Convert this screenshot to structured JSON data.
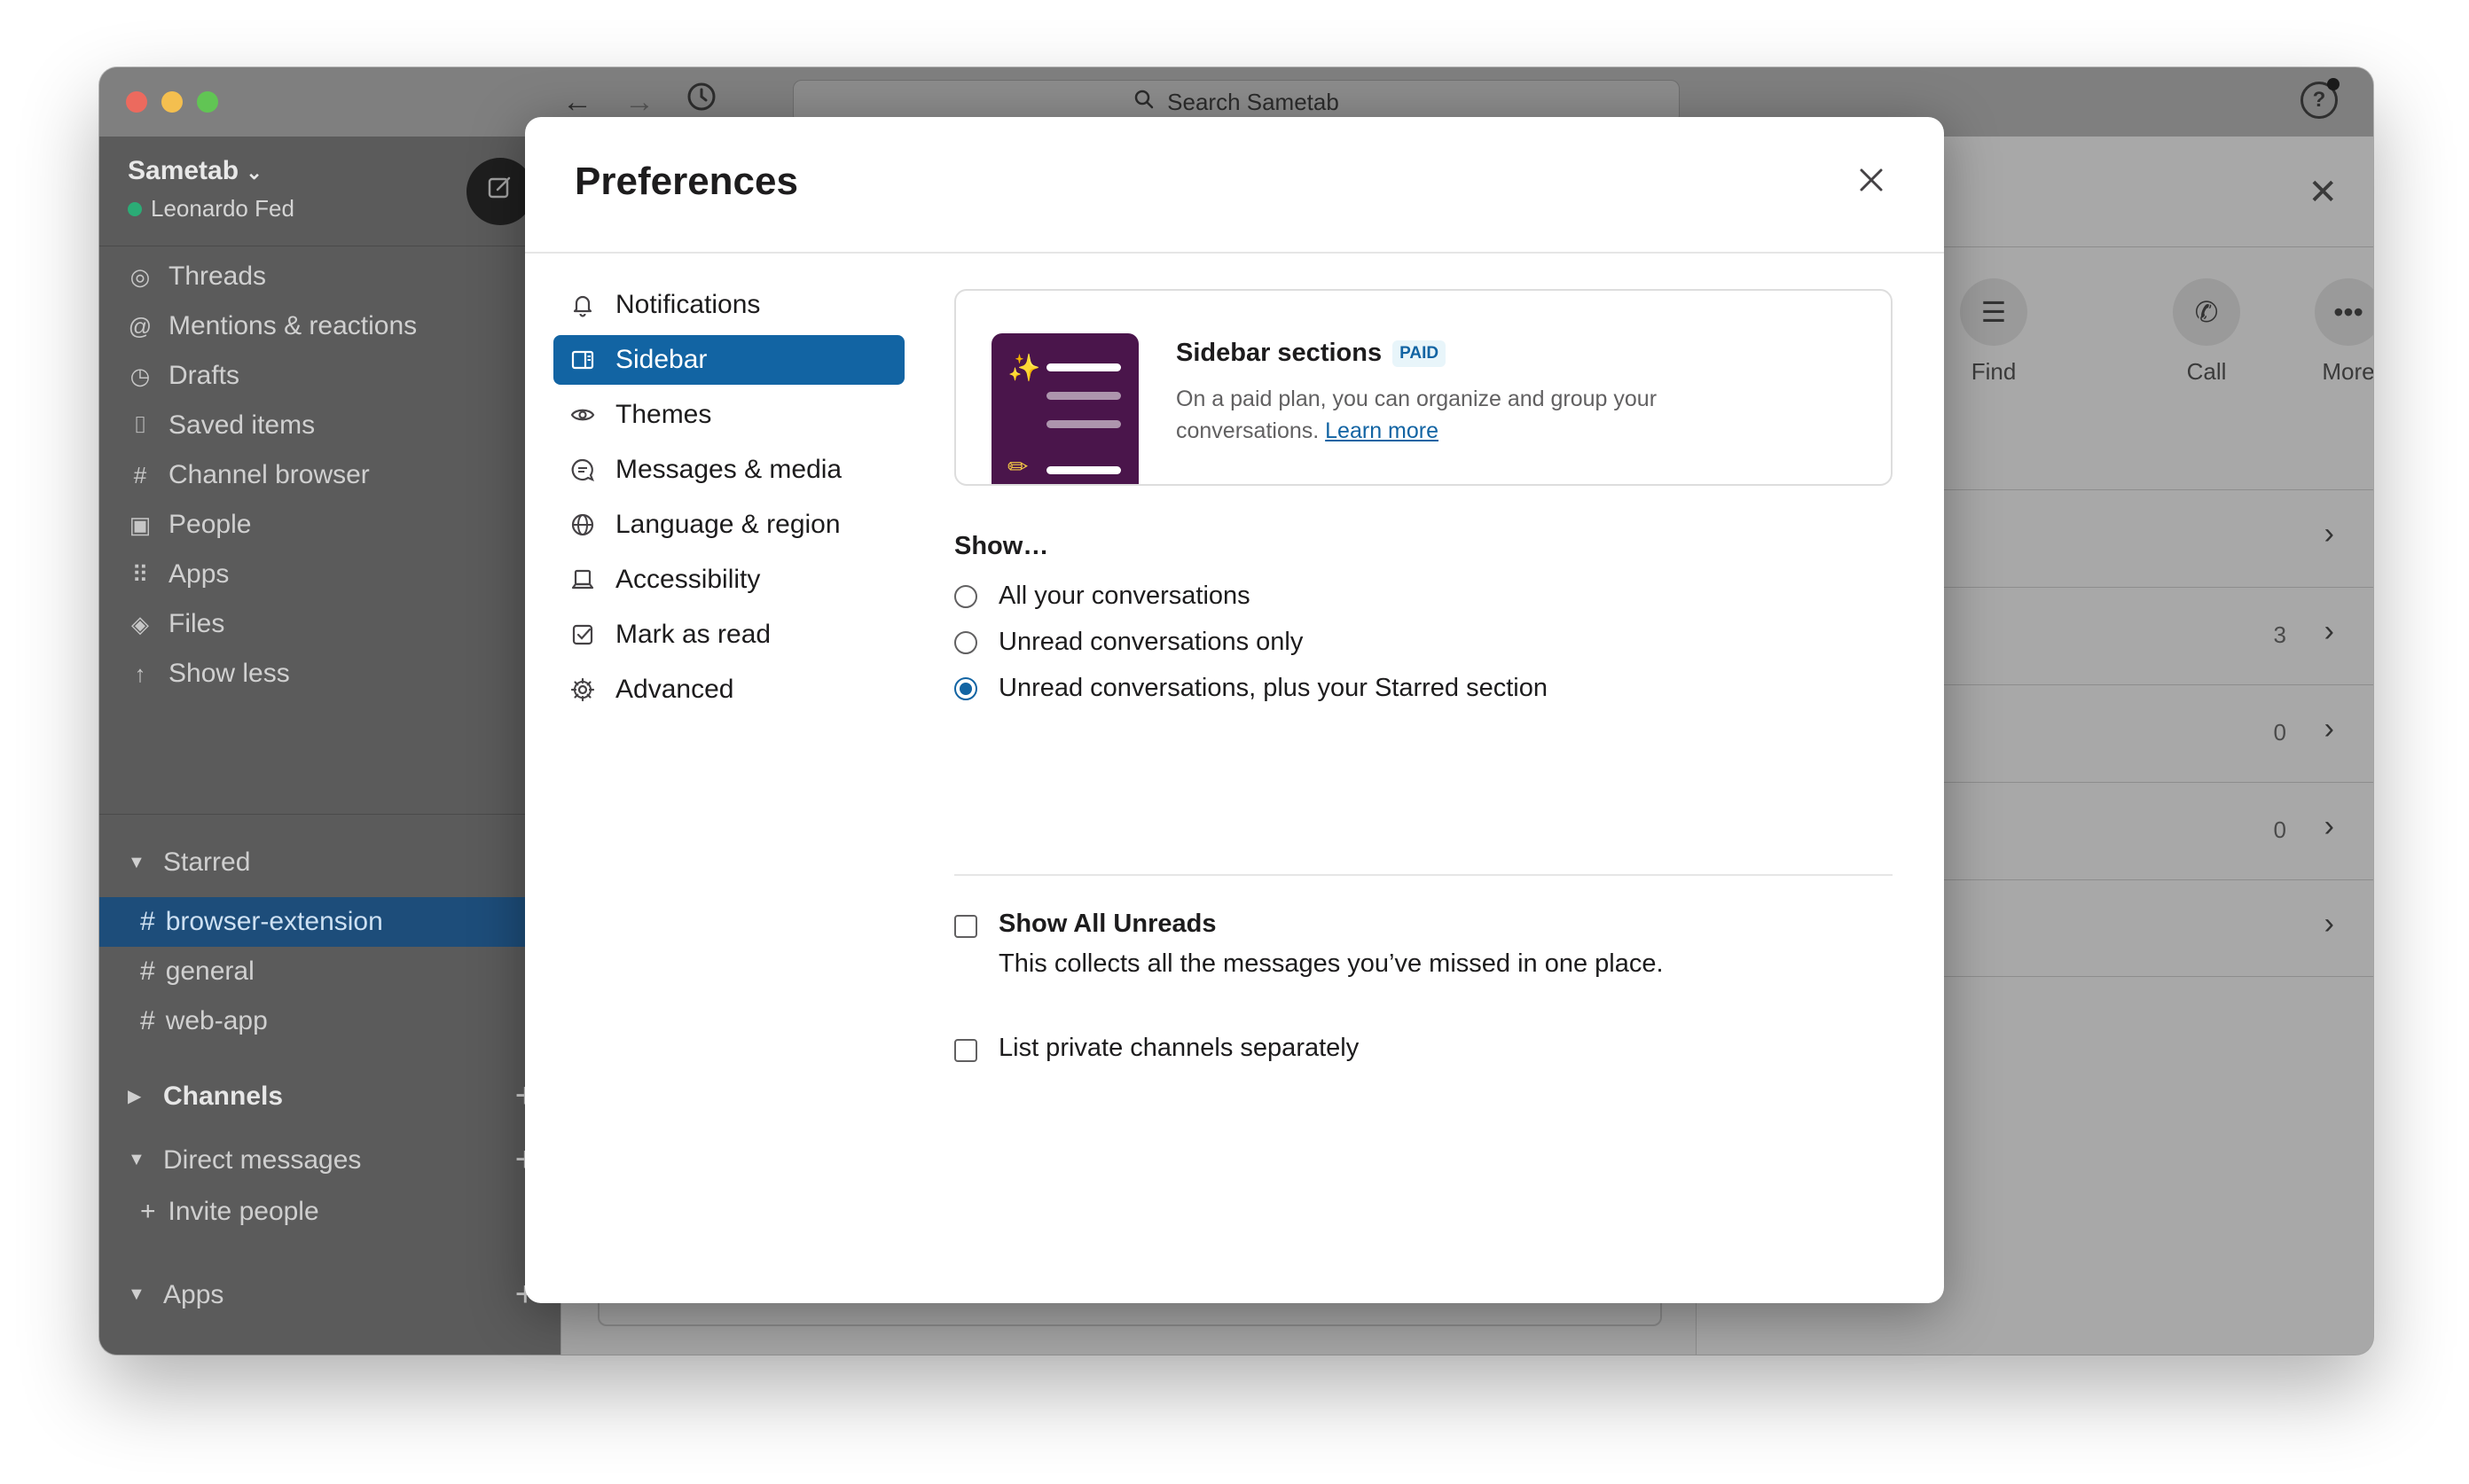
{
  "window": {
    "search_placeholder": "Search Sametab"
  },
  "workspace": {
    "name": "Sametab",
    "caret": "⌄",
    "user": "Leonardo Fed"
  },
  "sidebar_nav": [
    {
      "label": "Threads",
      "icon": "threads-icon"
    },
    {
      "label": "Mentions & reactions",
      "icon": "at-sign-icon"
    },
    {
      "label": "Drafts",
      "icon": "drafts-icon"
    },
    {
      "label": "Saved items",
      "icon": "bookmark-icon"
    },
    {
      "label": "Channel browser",
      "icon": "channel-browser-icon"
    },
    {
      "label": "People",
      "icon": "people-icon"
    },
    {
      "label": "Apps",
      "icon": "apps-grid-icon"
    },
    {
      "label": "Files",
      "icon": "files-icon"
    },
    {
      "label": "Show less",
      "icon": "arrow-up-icon"
    }
  ],
  "sections": {
    "starred": "Starred",
    "channels": "Channels",
    "direct_messages": "Direct messages",
    "invite": "Invite people",
    "apps": "Apps"
  },
  "starred_channels": [
    "browser-extension",
    "general",
    "web-app"
  ],
  "right_panel": {
    "actions": [
      {
        "label": "Find",
        "icon": "find-icon"
      },
      {
        "label": "Call",
        "icon": "phone-icon"
      },
      {
        "label": "More",
        "icon": "more-dots-icon"
      }
    ],
    "rows": [
      {
        "count": ""
      },
      {
        "count": "3"
      },
      {
        "count": "0"
      },
      {
        "count": "0"
      },
      {
        "count": ""
      }
    ]
  },
  "modal": {
    "title": "Preferences",
    "nav": [
      {
        "label": "Notifications",
        "icon": "bell-icon"
      },
      {
        "label": "Sidebar",
        "icon": "sidebar-icon",
        "active": true
      },
      {
        "label": "Themes",
        "icon": "eye-icon"
      },
      {
        "label": "Messages & media",
        "icon": "message-icon"
      },
      {
        "label": "Language & region",
        "icon": "globe-icon"
      },
      {
        "label": "Accessibility",
        "icon": "laptop-icon"
      },
      {
        "label": "Mark as read",
        "icon": "check-square-icon"
      },
      {
        "label": "Advanced",
        "icon": "gear-icon"
      }
    ],
    "promo": {
      "title": "Sidebar sections",
      "badge": "PAID",
      "description": "On a paid plan, you can organize and group your conversations.",
      "link": "Learn more"
    },
    "show_label": "Show…",
    "show_options": [
      {
        "label": "All your conversations",
        "checked": false
      },
      {
        "label": "Unread conversations only",
        "checked": false
      },
      {
        "label": "Unread conversations, plus your Starred section",
        "checked": true
      }
    ],
    "show_all_unreads": {
      "title": "Show All Unreads",
      "description": "This collects all the messages you’ve missed in one place.",
      "checked": false
    },
    "list_private": {
      "title": "List private channels separately",
      "checked": false
    }
  },
  "colors": {
    "accent": "#1264a3",
    "promo_bg": "#4a154b",
    "active_channel": "#1d4d7a",
    "presence": "#2bac76"
  }
}
